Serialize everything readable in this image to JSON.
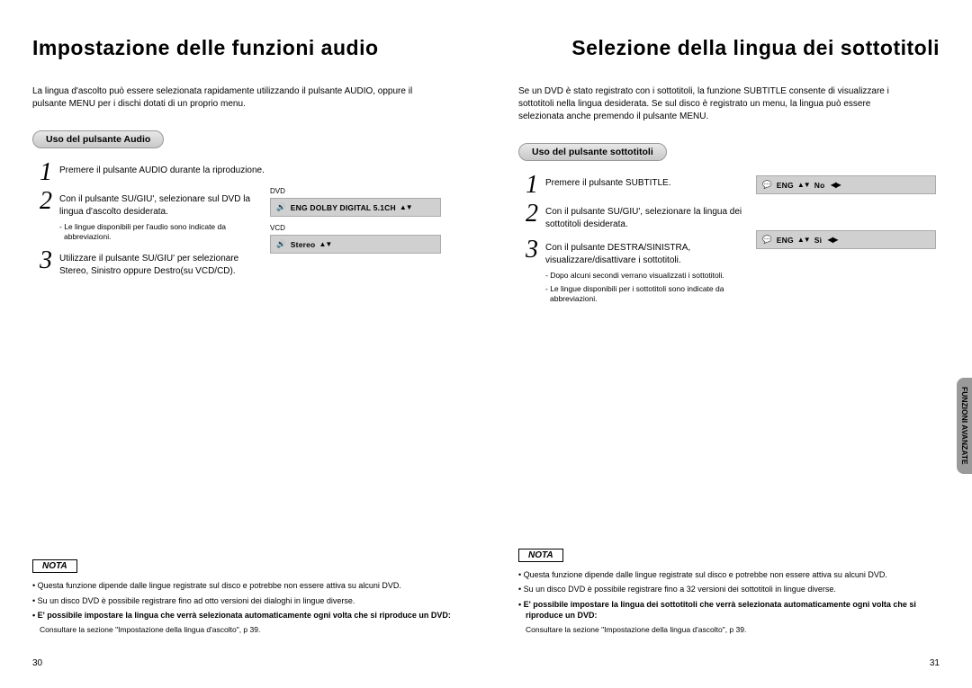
{
  "left": {
    "title": "Impostazione delle funzioni audio",
    "intro": "La lingua d'ascolto può essere selezionata rapidamente utilizzando il pulsante AUDIO, oppure il pulsante MENU per i dischi dotati di un proprio menu.",
    "pill": "Uso del pulsante Audio",
    "steps": {
      "s1": "Premere il pulsante AUDIO durante la riproduzione.",
      "s2": "Con il pulsante SU/GIU', selezionare sul DVD la lingua d'ascolto desiderata.",
      "s2note": "- Le lingue disponibili per l'audio sono indicate da abbreviazioni.",
      "s3": "Utilizzare il pulsante SU/GIU' per selezionare Stereo, Sinistro oppure Destro(su VCD/CD)."
    },
    "osd": {
      "dvdLabel": "DVD",
      "dvdText": "ENG DOLBY DIGITAL 5.1CH",
      "vcdLabel": "VCD",
      "vcdText": "Stereo"
    },
    "nota": {
      "label": "NOTA",
      "n1": "Questa funzione dipende dalle lingue registrate sul disco e potrebbe non essere attiva su alcuni DVD.",
      "n2": "Su un disco DVD è possibile registrare fino ad otto versioni dei dialoghi in lingue diverse.",
      "n3": "E' possibile impostare la lingua che verrà selezionata automaticamente ogni volta che si riproduce un DVD:",
      "n3sub": "Consultare la sezione \"Impostazione della lingua d'ascolto\", p 39."
    },
    "pagenum": "30"
  },
  "right": {
    "title": "Selezione della lingua dei sottotitoli",
    "intro": "Se un DVD è stato registrato con i sottotitoli, la funzione SUBTITLE consente di visualizzare i sottotitoli nella lingua desiderata. Se sul disco è registrato un menu, la lingua può essere selezionata anche premendo il pulsante MENU.",
    "pill": "Uso del pulsante sottotitoli",
    "steps": {
      "s1": "Premere il pulsante SUBTITLE.",
      "s2": "Con il pulsante SU/GIU', selezionare la lingua dei sottotitoli desiderata.",
      "s3": "Con il pulsante DESTRA/SINISTRA, visualizzare/disattivare i sottotitoli.",
      "s3note1": "- Dopo alcuni secondi verrano visualizzati i sottotitoli.",
      "s3note2": "- Le lingue disponibili per i sottotitoli sono indicate da abbreviazioni."
    },
    "osd": {
      "row1a": "ENG",
      "row1arrows": "▲▼",
      "row1b": "No",
      "row1lr": "◀▶",
      "row2a": "ENG",
      "row2arrows": "▲▼",
      "row2b": "Sì",
      "row2lr": "◀▶"
    },
    "nota": {
      "label": "NOTA",
      "n1": "Questa funzione dipende dalle lingue registrate sul disco e potrebbe non essere attiva su alcuni DVD.",
      "n2": "Su un disco DVD è possibile registrare fino a 32 versioni dei sottotitoli in lingue diverse.",
      "n3": "E' possibile impostare la lingua dei sottotitoli che verrà selezionata automaticamente ogni volta che si riproduce un DVD:",
      "n3sub": "Consultare la sezione \"Impostazione della lingua d'ascolto\", p 39."
    },
    "pagenum": "31"
  },
  "sidetab": "FUNZIONI\nAVANZATE"
}
